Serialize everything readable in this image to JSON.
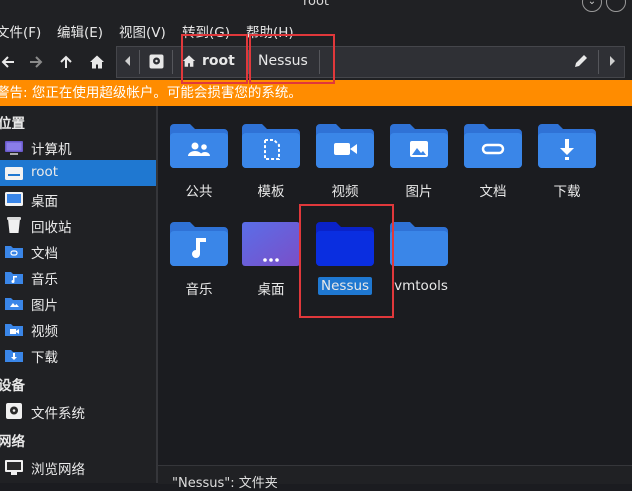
{
  "window": {
    "title": "root"
  },
  "menubar": {
    "file": "文件(F)",
    "edit": "编辑(E)",
    "view": "视图(V)",
    "go": "转到(G)",
    "help": "帮助(H)"
  },
  "pathbar": {
    "crumbs": [
      "root",
      "Nessus"
    ]
  },
  "warning": "警告: 您正在使用超级帐户。可能会损害您的系统。",
  "sidebar": {
    "places_header": "位置",
    "places": [
      "计算机",
      "root",
      "桌面",
      "回收站",
      "文档",
      "音乐",
      "图片",
      "视频",
      "下载"
    ],
    "devices_header": "设备",
    "devices": [
      "文件系统"
    ],
    "network_header": "网络",
    "network": [
      "浏览网络"
    ]
  },
  "files": [
    {
      "name": "公共",
      "icon": "share-folder-icon"
    },
    {
      "name": "模板",
      "icon": "template-folder-icon"
    },
    {
      "name": "视频",
      "icon": "video-folder-icon"
    },
    {
      "name": "图片",
      "icon": "picture-folder-icon"
    },
    {
      "name": "文档",
      "icon": "document-folder-icon"
    },
    {
      "name": "下载",
      "icon": "download-folder-icon"
    },
    {
      "name": "音乐",
      "icon": "music-folder-icon"
    },
    {
      "name": "桌面",
      "icon": "desktop-folder-icon"
    },
    {
      "name": "Nessus",
      "icon": "folder-icon"
    },
    {
      "name": "vmtools",
      "icon": "folder-icon"
    }
  ],
  "status": "\"Nessus\": 文件夹",
  "colors": {
    "accent": "#1f78d1",
    "warning": "#ff8c00",
    "folder": "#3a86e8",
    "folder_selected": "#0a2ee0",
    "annotation": "#e0383b"
  }
}
